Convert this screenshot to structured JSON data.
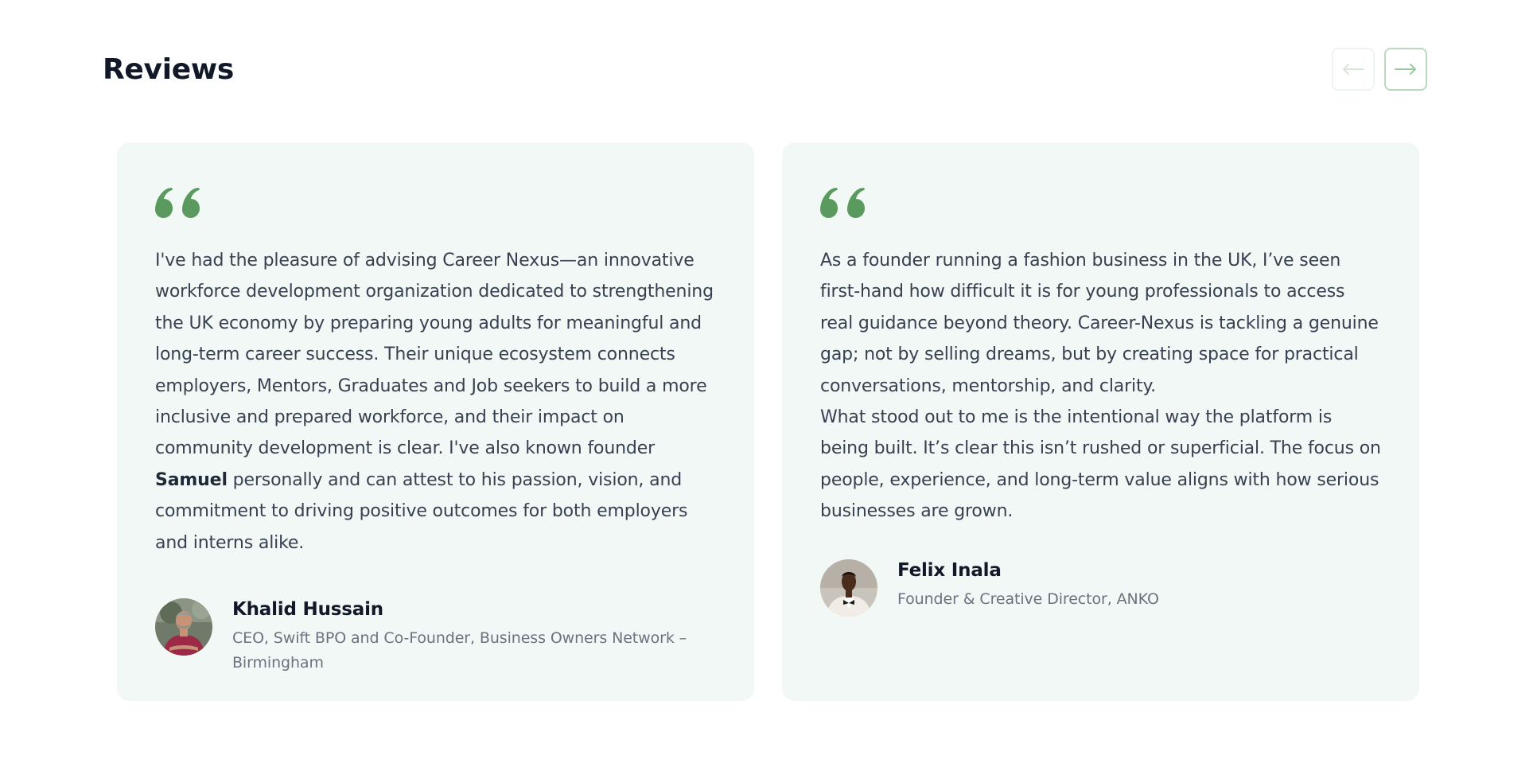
{
  "section": {
    "title": "Reviews"
  },
  "nav": {
    "prev_icon": "arrow-left-icon",
    "next_icon": "arrow-right-icon"
  },
  "colors": {
    "accent": "#5a9a5f",
    "card_bg": "#f2f8f5",
    "heading": "#111827",
    "body_text": "#374151",
    "muted_text": "#6b7280"
  },
  "reviews": [
    {
      "quote_icon": "quote-icon",
      "text_part1": "I've had the pleasure of advising Career Nexus—an innovative workforce development organization dedicated to strengthening the UK economy by preparing young adults for meaningful and long-term career success. Their unique ecosystem connects employers, Mentors, Graduates and Job seekers to build a more inclusive and prepared workforce, and their impact on community development is clear. I've also known founder ",
      "text_bold": "Samuel",
      "text_part2": " personally and can attest to his passion, vision, and commitment to driving positive outcomes for both employers and interns alike.",
      "author_name": "Khalid Hussain",
      "author_role": "CEO, Swift BPO and Co-Founder, Business Owners Network – Birmingham"
    },
    {
      "quote_icon": "quote-icon",
      "paragraph1": "As a founder running a fashion business in the UK, I’ve seen first-hand how difficult it is for young professionals to access real guidance beyond theory. Career-Nexus is tackling a genuine gap; not by selling dreams, but by creating space for practical conversations, mentorship, and clarity.",
      "paragraph2": "What stood out to me is the intentional way the platform is being built. It’s clear this isn’t rushed or superficial. The focus on people, experience, and long-term value aligns with how serious businesses are grown.",
      "author_name": "Felix Inala",
      "author_role": "Founder & Creative Director, ANKO"
    }
  ]
}
